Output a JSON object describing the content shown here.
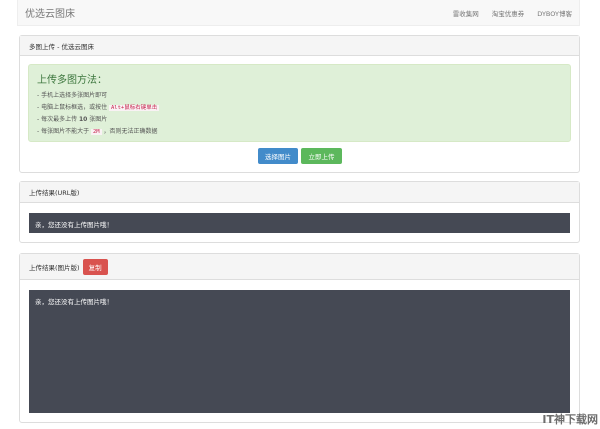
{
  "navbar": {
    "brand": "优选云图床",
    "links": [
      "雷收集网",
      "淘宝优惠券",
      "DYBOY博客"
    ]
  },
  "multi_upload": {
    "title": "多图上传 - 优选云图床",
    "alert_heading": "上传多图方法：",
    "tips": [
      {
        "pre": "- 手机上选择多张图片即可"
      },
      {
        "pre": "- 电脑上鼠标框选，或按住 ",
        "code": "Alt+鼠标右键单击",
        "post": ""
      },
      {
        "pre": "- 每次最多上传 ",
        "bold": "10",
        "post": " 张图片"
      },
      {
        "pre": "- 每张图片不能大于 ",
        "code": "2M",
        "post": " ，否则无法正确数据"
      }
    ],
    "select_button": "选择图片",
    "upload_button": "立即上传",
    "colors": {
      "select": "#428bca",
      "upload": "#5cb85c"
    }
  },
  "url_result": {
    "title": "上传结果(URL版)",
    "message": "亲，您还没有上传图片哦！"
  },
  "image_result": {
    "title": "上传结果(图片版)",
    "copy_button": "复制",
    "copy_color": "#d9534f",
    "message": "亲，您还没有上传图片哦！"
  },
  "watermark": "IT神下载网"
}
